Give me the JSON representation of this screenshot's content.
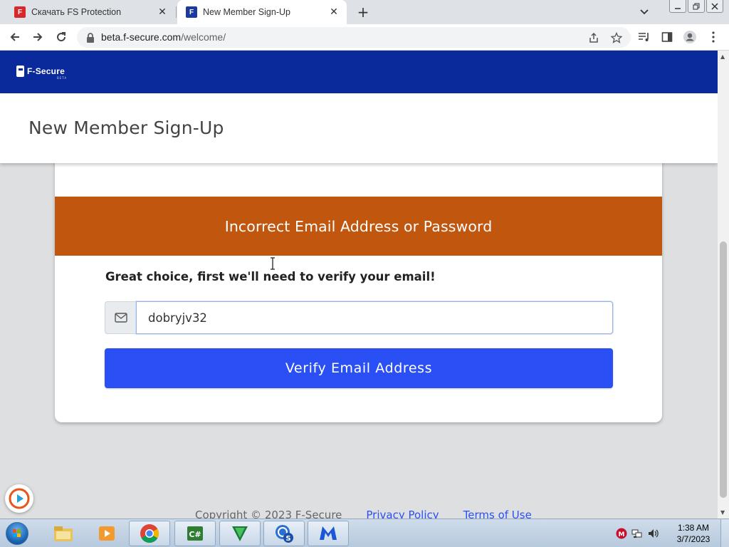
{
  "browser": {
    "tabs": [
      {
        "title": "Скачать FS Protection",
        "favicon": "f-secure-red-icon",
        "active": false
      },
      {
        "title": "New Member Sign-Up",
        "favicon": "f-secure-blue-icon",
        "active": true
      }
    ],
    "url_host": "beta.f-secure.com",
    "url_path": "/welcome/"
  },
  "site": {
    "brand": "F-Secure",
    "brand_sub": "BETA",
    "page_title": "New Member Sign-Up",
    "error_message": "Incorrect Email Address or Password",
    "prompt": "Great choice, first we'll need to verify your email!",
    "email_value": "dobryjv32",
    "verify_button": "Verify Email Address",
    "footer": {
      "copyright": "Copyright © 2023 F-Secure",
      "privacy": "Privacy Policy",
      "terms": "Terms of Use"
    }
  },
  "colors": {
    "header_blue": "#0a2a9b",
    "error_orange": "#c1570e",
    "button_blue": "#2a50f5"
  },
  "taskbar": {
    "apps": [
      "windows-explorer-icon",
      "media-player-icon",
      "chrome-icon",
      "csharp-icon",
      "shield-app-icon",
      "f-secure-s-icon",
      "malwarebytes-icon"
    ],
    "time": "1:38 AM",
    "date": "3/7/2023"
  }
}
